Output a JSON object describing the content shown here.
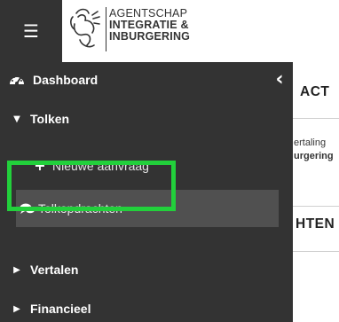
{
  "header": {
    "menu_icon": "hamburger-icon",
    "logo": {
      "line1": "AGENTSCHAP",
      "line2": "INTEGRATIE &",
      "line3": "INBURGERING"
    }
  },
  "sidebar": {
    "dashboard": {
      "label": "Dashboard",
      "icon": "tachometer-icon"
    },
    "collapse_icon": "chevron-left-icon",
    "tolken": {
      "label": "Tolken",
      "icon": "caret-down-icon"
    },
    "nieuwe_aanvraag": {
      "label": "Nieuwe aanvraag",
      "icon": "plus-icon"
    },
    "tolkopdrachten": {
      "label": "Tolkopdrachten",
      "icon": "comments-icon"
    },
    "vertalen": {
      "label": "Vertalen",
      "icon": "caret-right-icon"
    },
    "financieel": {
      "label": "Financieel",
      "icon": "caret-right-icon"
    }
  },
  "background": {
    "heading1": "ACT",
    "text1": "ertaling",
    "text2": "urgering",
    "heading2": "HTEN"
  },
  "colors": {
    "sidebar": "#333333",
    "active_item": "#505050",
    "highlight": "#22d03b"
  }
}
